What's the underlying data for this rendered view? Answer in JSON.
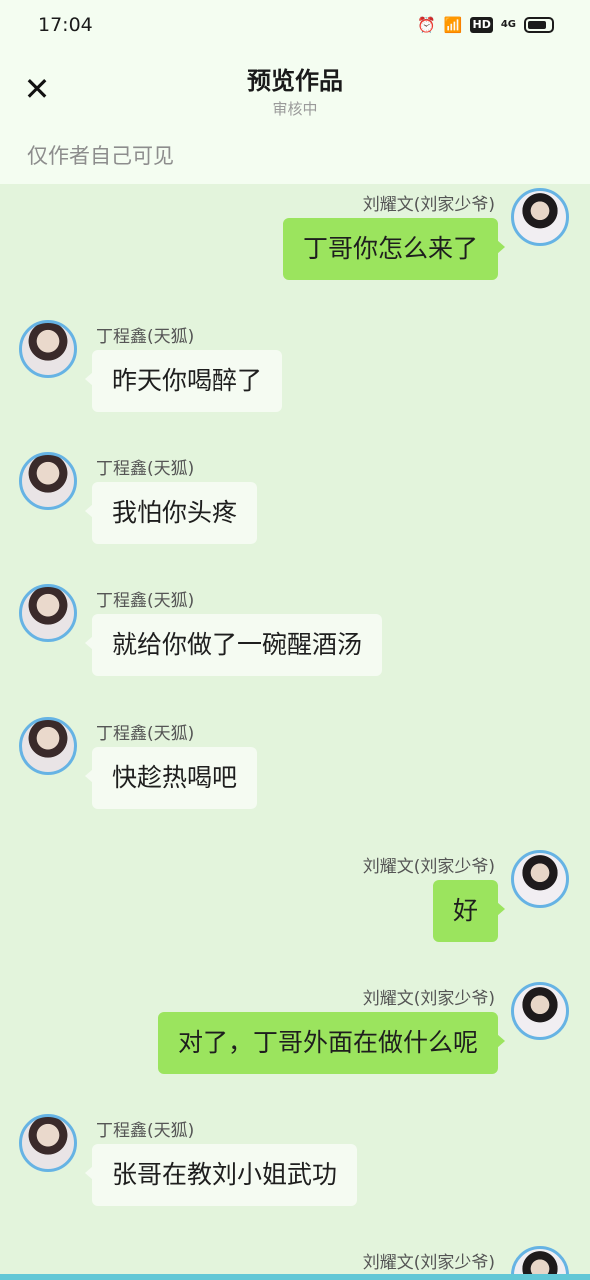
{
  "status_bar": {
    "time": "17:04",
    "icons": [
      "alarm-icon",
      "wifi-icon",
      "hd-icon",
      "4g-signal-icon",
      "battery-icon"
    ],
    "hd_label": "HD",
    "network_label": "4G"
  },
  "header": {
    "title": "预览作品",
    "subtitle": "审核中",
    "close_symbol": "✕"
  },
  "visibility_note": "仅作者自己可见",
  "messages": [
    {
      "side": "right",
      "name": "刘耀文(刘家少爷)",
      "text": "丁哥你怎么来了"
    },
    {
      "side": "left",
      "name": "丁程鑫(天狐)",
      "text": "昨天你喝醉了"
    },
    {
      "side": "left",
      "name": "丁程鑫(天狐)",
      "text": "我怕你头疼"
    },
    {
      "side": "left",
      "name": "丁程鑫(天狐)",
      "text": "就给你做了一碗醒酒汤"
    },
    {
      "side": "left",
      "name": "丁程鑫(天狐)",
      "text": "快趁热喝吧"
    },
    {
      "side": "right",
      "name": "刘耀文(刘家少爷)",
      "text": "好"
    },
    {
      "side": "right",
      "name": "刘耀文(刘家少爷)",
      "text": "对了，丁哥外面在做什么呢"
    },
    {
      "side": "left",
      "name": "丁程鑫(天狐)",
      "text": "张哥在教刘小姐武功"
    },
    {
      "side": "right",
      "name": "刘耀文(刘家少爷)",
      "text": ""
    }
  ],
  "colors": {
    "right_bubble": "#9be45e",
    "left_bubble": "#f5fbf2",
    "chat_background": "#e3f4dc",
    "avatar_border": "#66b3e4"
  }
}
